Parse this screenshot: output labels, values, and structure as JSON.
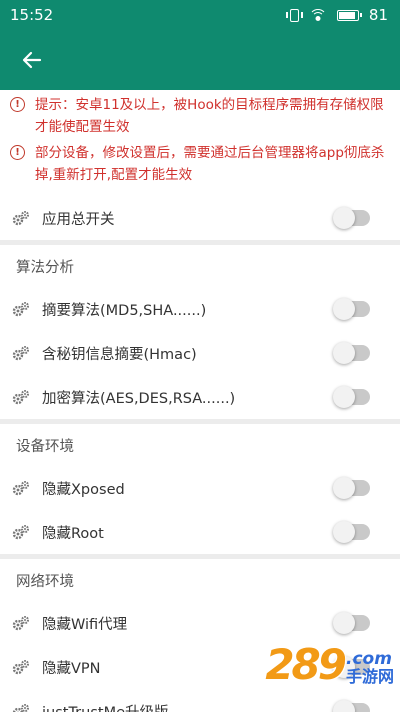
{
  "status_bar": {
    "time": "15:52",
    "battery": "81"
  },
  "warnings": [
    {
      "text": "提示：安卓11及以上，被Hook的目标程序需拥有存储权限才能使配置生效"
    },
    {
      "text": "部分设备，修改设置后，需要通过后台管理器将app彻底杀掉,重新打开,配置才能生效"
    }
  ],
  "master": {
    "label": "应用总开关",
    "on": false
  },
  "sections": [
    {
      "title": "算法分析",
      "items": [
        {
          "label": "摘要算法(MD5,SHA......)",
          "on": false
        },
        {
          "label": "含秘钥信息摘要(Hmac)",
          "on": false
        },
        {
          "label": "加密算法(AES,DES,RSA......)",
          "on": false
        }
      ]
    },
    {
      "title": "设备环境",
      "items": [
        {
          "label": "隐藏Xposed",
          "on": false
        },
        {
          "label": "隐藏Root",
          "on": false
        }
      ]
    },
    {
      "title": "网络环境",
      "items": [
        {
          "label": "隐藏Wifi代理",
          "on": false
        },
        {
          "label": "隐藏VPN",
          "on": false
        },
        {
          "label": "justTrustMe升级版",
          "on": false
        }
      ]
    }
  ],
  "watermark": {
    "digits": "289",
    "suffix": ".com",
    "cn": "手游网"
  },
  "colors": {
    "primary": "#0f8a6f",
    "warning": "#d0312d",
    "toggle_off_track": "#c9c9c9"
  }
}
